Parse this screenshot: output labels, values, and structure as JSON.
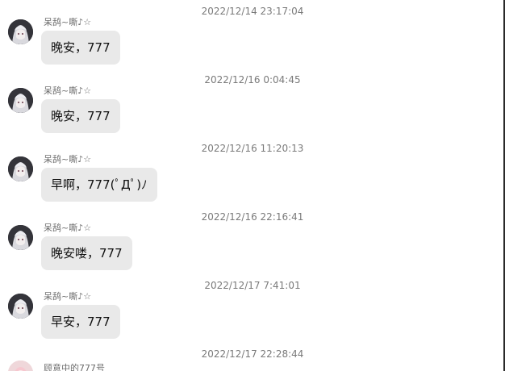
{
  "conversation": [
    {
      "timestamp": "2022/12/14 23:17:04",
      "sender": "呆鸹~嘶♪☆",
      "text": "晚安，777",
      "avatar": "anime-avatar-icon"
    },
    {
      "timestamp": "2022/12/16 0:04:45",
      "sender": "呆鸹~嘶♪☆",
      "text": "晚安，777",
      "avatar": "anime-avatar-icon"
    },
    {
      "timestamp": "2022/12/16 11:20:13",
      "sender": "呆鸹~嘶♪☆",
      "text": "早啊，777(ﾟДﾟ)ﾉ",
      "avatar": "anime-avatar-icon"
    },
    {
      "timestamp": "2022/12/16 22:16:41",
      "sender": "呆鸹~嘶♪☆",
      "text": "晚安喽，777",
      "avatar": "anime-avatar-icon"
    },
    {
      "timestamp": "2022/12/17 7:41:01",
      "sender": "呆鸹~嘶♪☆",
      "text": "早安，777",
      "avatar": "anime-avatar-icon"
    },
    {
      "timestamp": "2022/12/17 22:28:44",
      "sender": "顾意中的777号",
      "avatar": "pink-avatar-icon"
    }
  ],
  "colors": {
    "bubble": "#e9e9e9",
    "timestamp": "#7a7a7a",
    "sender": "#6d6d6d",
    "border": "#2a2a2a"
  }
}
